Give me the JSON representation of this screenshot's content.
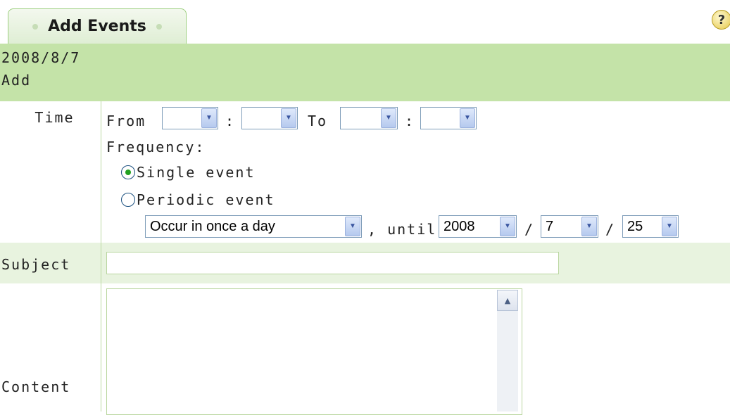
{
  "tab": {
    "label": "Add Events"
  },
  "help": {
    "symbol": "?"
  },
  "header": {
    "date": "2008/8/7",
    "action": "Add"
  },
  "time": {
    "label": "Time",
    "from_label": "From",
    "colon": ":",
    "to_label": "To",
    "frequency_label": "Frequency:",
    "single_event_label": "Single event",
    "periodic_event_label": "Periodic event",
    "selected_frequency": "single",
    "occurrence": "Occur in once a day",
    "until_label": ", until",
    "date_sep": "/",
    "until_year": "2008",
    "until_month": "7",
    "until_day": "25"
  },
  "subject": {
    "label": "Subject",
    "value": ""
  },
  "content": {
    "label": "Content",
    "value": ""
  },
  "colors": {
    "accent": "#c4e3a8",
    "light_band": "#e8f3df",
    "border": "#9ccf7e"
  }
}
